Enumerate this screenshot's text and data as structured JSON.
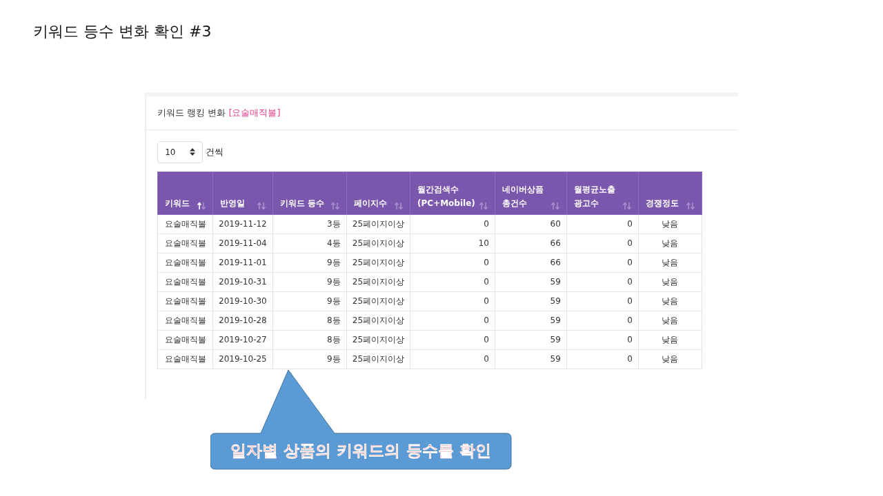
{
  "slide_title": "키워드 등수 변화 확인 #3",
  "panel": {
    "title": "키워드 랭킹 변화",
    "keyword": "[요술매직볼]",
    "page_size": "10",
    "page_size_suffix": "건씩",
    "table": {
      "columns": [
        {
          "label": "키워드",
          "sorted": true
        },
        {
          "label": "반영일",
          "sorted": false
        },
        {
          "label": "키워드 등수",
          "sorted": false
        },
        {
          "label": "페이지수",
          "sorted": false
        },
        {
          "label": "월간검색수\n(PC+Mobile)",
          "sorted": false
        },
        {
          "label": "네이버상품\n총건수",
          "sorted": false
        },
        {
          "label": "월평균노출\n광고수",
          "sorted": false
        },
        {
          "label": "경쟁정도",
          "sorted": false
        }
      ],
      "rows": [
        [
          "요술매직볼",
          "2019-11-12",
          "3등",
          "25페이지이상",
          "0",
          "60",
          "0",
          "낮음"
        ],
        [
          "요술매직볼",
          "2019-11-04",
          "4등",
          "25페이지이상",
          "10",
          "66",
          "0",
          "낮음"
        ],
        [
          "요술매직볼",
          "2019-11-01",
          "9등",
          "25페이지이상",
          "0",
          "66",
          "0",
          "낮음"
        ],
        [
          "요술매직볼",
          "2019-10-31",
          "9등",
          "25페이지이상",
          "0",
          "59",
          "0",
          "낮음"
        ],
        [
          "요술매직볼",
          "2019-10-30",
          "9등",
          "25페이지이상",
          "0",
          "59",
          "0",
          "낮음"
        ],
        [
          "요술매직볼",
          "2019-10-28",
          "8등",
          "25페이지이상",
          "0",
          "59",
          "0",
          "낮음"
        ],
        [
          "요술매직볼",
          "2019-10-27",
          "8등",
          "25페이지이상",
          "0",
          "59",
          "0",
          "낮음"
        ],
        [
          "요술매직볼",
          "2019-10-25",
          "9등",
          "25페이지이상",
          "0",
          "59",
          "0",
          "낮음"
        ]
      ]
    }
  },
  "callout": {
    "text": "일자별 상품의 키워드의 등수를 확인"
  }
}
